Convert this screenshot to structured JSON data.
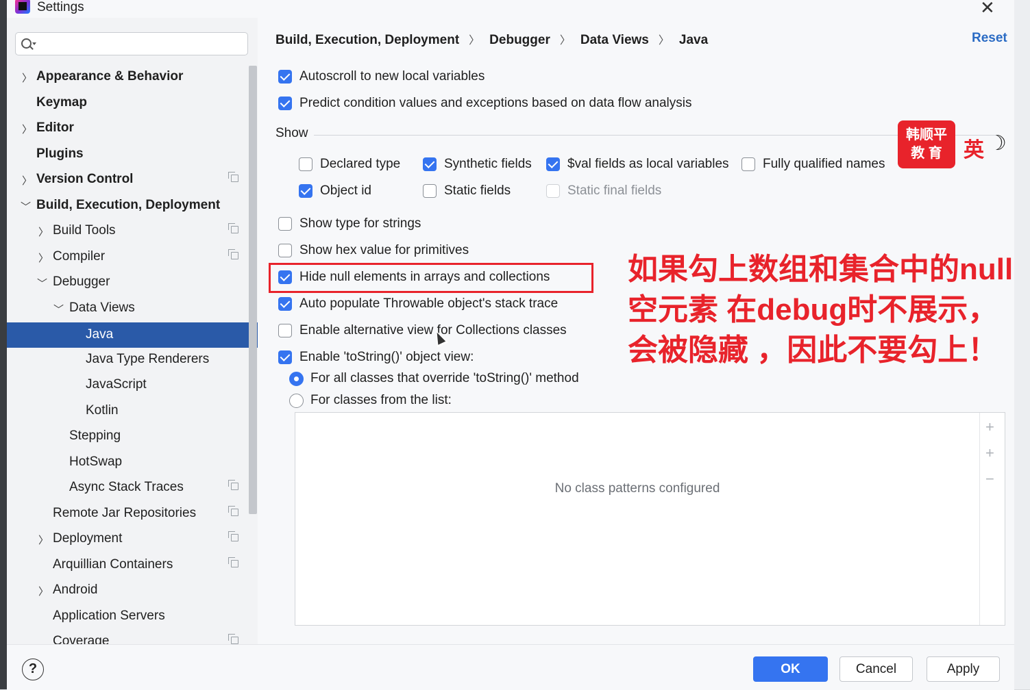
{
  "window": {
    "title": "Settings"
  },
  "search": {
    "placeholder": ""
  },
  "sidebar": {
    "items": [
      {
        "label": "Appearance & Behavior"
      },
      {
        "label": "Keymap"
      },
      {
        "label": "Editor"
      },
      {
        "label": "Plugins"
      },
      {
        "label": "Version Control"
      },
      {
        "label": "Build, Execution, Deployment"
      },
      {
        "label": "Build Tools"
      },
      {
        "label": "Compiler"
      },
      {
        "label": "Debugger"
      },
      {
        "label": "Data Views"
      },
      {
        "label": "Java"
      },
      {
        "label": "Java Type Renderers"
      },
      {
        "label": "JavaScript"
      },
      {
        "label": "Kotlin"
      },
      {
        "label": "Stepping"
      },
      {
        "label": "HotSwap"
      },
      {
        "label": "Async Stack Traces"
      },
      {
        "label": "Remote Jar Repositories"
      },
      {
        "label": "Deployment"
      },
      {
        "label": "Arquillian Containers"
      },
      {
        "label": "Android"
      },
      {
        "label": "Application Servers"
      },
      {
        "label": "Coverage"
      }
    ]
  },
  "breadcrumb": [
    "Build, Execution, Deployment",
    "Debugger",
    "Data Views",
    "Java"
  ],
  "reset_label": "Reset",
  "options": {
    "autoscroll": {
      "label": "Autoscroll to new local variables",
      "checked": true
    },
    "predict": {
      "label": "Predict condition values and exceptions based on data flow analysis",
      "checked": true
    },
    "show_label": "Show",
    "declared_type": {
      "label": "Declared type",
      "checked": false
    },
    "synthetic_fields": {
      "label": "Synthetic fields",
      "checked": true
    },
    "val_fields": {
      "label": "$val fields as local variables",
      "checked": true
    },
    "fully_qualified": {
      "label": "Fully qualified names",
      "checked": false
    },
    "object_id": {
      "label": "Object id",
      "checked": true
    },
    "static_fields": {
      "label": "Static fields",
      "checked": false
    },
    "static_final_fields": {
      "label": "Static final fields",
      "checked": false,
      "disabled": true
    },
    "type_strings": {
      "label": "Show type for strings",
      "checked": false
    },
    "hex_primitives": {
      "label": "Show hex value for primitives",
      "checked": false
    },
    "hide_null": {
      "label": "Hide null elements in arrays and collections",
      "checked": true
    },
    "throwable": {
      "label": "Auto populate Throwable object's stack trace",
      "checked": true
    },
    "alt_view": {
      "label": "Enable alternative view for Collections classes",
      "checked": false
    },
    "tostring": {
      "label": "Enable 'toString()' object view:",
      "checked": true
    },
    "tostring_all": {
      "label": "For all classes that override 'toString()' method",
      "selected": true
    },
    "tostring_list": {
      "label": "For classes from the list:",
      "selected": false
    }
  },
  "class_list": {
    "empty_text": "No class patterns configured"
  },
  "annotation": {
    "lines": [
      "如果勾上数组和集合中的null",
      "空元素 在debug时不展示，",
      "会被隐藏 ，因此不要勾上！"
    ],
    "color": "#e8232b"
  },
  "overlay": {
    "logo_line1": "韩顺平",
    "logo_line2": "教 育",
    "ime_char": "英"
  },
  "footer": {
    "help": "?",
    "ok": "OK",
    "cancel": "Cancel",
    "apply": "Apply"
  },
  "colors": {
    "accent": "#3574f0",
    "selection": "#2a5aa8",
    "highlight": "#e8232b"
  }
}
